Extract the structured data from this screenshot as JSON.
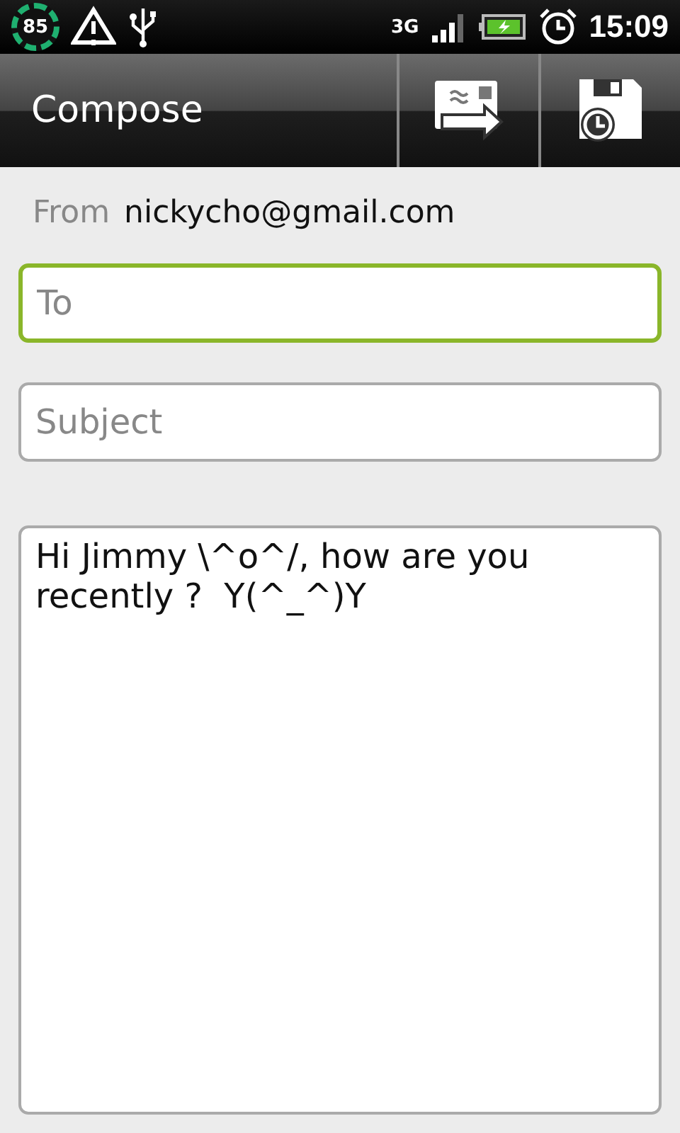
{
  "status_bar": {
    "badge": "85",
    "network": "3G",
    "time": "15:09"
  },
  "header": {
    "title": "Compose"
  },
  "from": {
    "label": "From",
    "value": "nickycho@gmail.com"
  },
  "fields": [
    {
      "kind": "to",
      "placeholder": "To",
      "focused": true
    },
    {
      "kind": "subject",
      "placeholder": "Subject",
      "focused": false
    }
  ],
  "body": {
    "value": "Hi Jimmy \\^o^/, how are you recently ?  Y(^_^)Y"
  }
}
